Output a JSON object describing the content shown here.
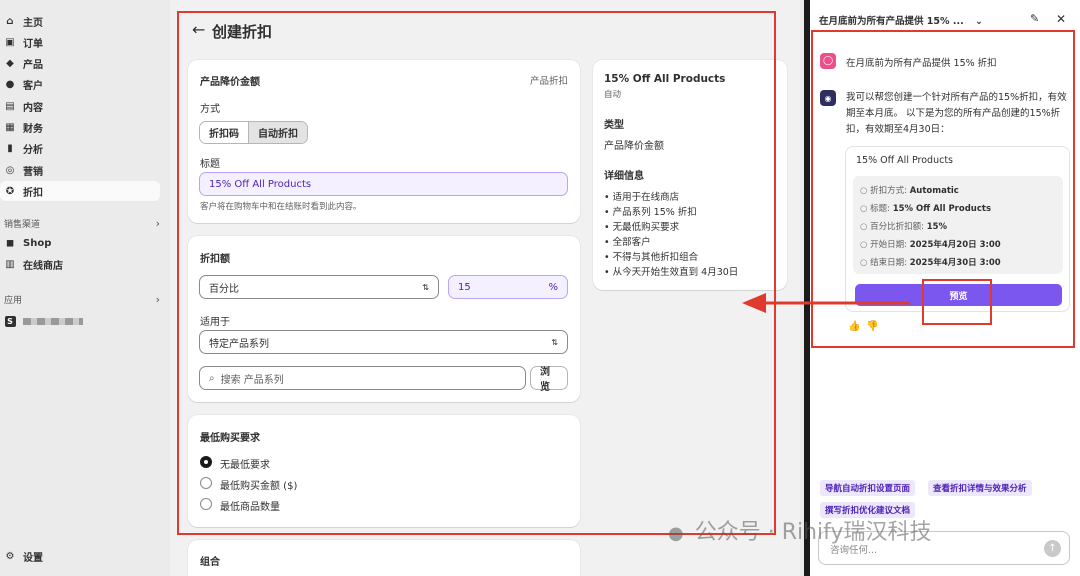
{
  "sidebar": {
    "items": [
      {
        "label": "主页",
        "icon": "home-icon"
      },
      {
        "label": "订单",
        "icon": "orders-icon"
      },
      {
        "label": "产品",
        "icon": "tag-icon"
      },
      {
        "label": "客户",
        "icon": "person-icon"
      },
      {
        "label": "内容",
        "icon": "content-icon"
      },
      {
        "label": "财务",
        "icon": "bank-icon"
      },
      {
        "label": "分析",
        "icon": "chart-icon"
      },
      {
        "label": "营销",
        "icon": "target-icon"
      },
      {
        "label": "折扣",
        "icon": "discount-icon"
      }
    ],
    "channels_label": "销售渠道",
    "channels": [
      {
        "label": "Shop",
        "icon": "shop-icon"
      },
      {
        "label": "在线商店",
        "icon": "store-icon"
      }
    ],
    "apps_label": "应用",
    "settings_label": "设置"
  },
  "main": {
    "back_icon": "arrow-left-icon",
    "title": "创建折扣",
    "card1": {
      "heading": "产品降价金额",
      "type_tag": "产品折扣",
      "method_label": "方式",
      "method_options": [
        "折扣码",
        "自动折扣"
      ],
      "title_label": "标题",
      "title_value": "15% Off All Products",
      "title_help": "客户将在购物车中和在结账时看到此内容。"
    },
    "card2": {
      "heading": "折扣额",
      "type_value": "百分比",
      "percent_value": "15",
      "percent_suffix": "%",
      "applies_label": "适用于",
      "applies_value": "特定产品系列",
      "search_placeholder": "搜索 产品系列",
      "browse_label": "浏览"
    },
    "card3": {
      "heading": "最低购买要求",
      "options": [
        "无最低要求",
        "最低购买金额 ($)",
        "最低商品数量"
      ]
    },
    "card4": {
      "heading": "组合"
    },
    "summary": {
      "title": "15% Off All Products",
      "subtitle": "自动",
      "type_label": "类型",
      "type_value": "产品降价金额",
      "details_label": "详细信息",
      "details": [
        "适用于在线商店",
        "产品系列 15% 折扣",
        "无最低购买要求",
        "全部客户",
        "不得与其他折扣组合",
        "从今天开始生效直到 4月30日"
      ]
    }
  },
  "panel": {
    "header_title": "在月底前为所有产品提供 15% ...",
    "user_message": "在月底前为所有产品提供 15% 折扣",
    "assistant_message": "我可以帮您创建一个针对所有产品的15%折扣，有效期至本月底。 以下是为您的所有产品创建的15%折扣，有效期至4月30日：",
    "card_title": "15% Off All Products",
    "card_items": [
      {
        "key": "折扣方式: ",
        "value": "Automatic"
      },
      {
        "key": "标题: ",
        "value": "15% Off All Products"
      },
      {
        "key": "百分比折扣额: ",
        "value": "15%"
      },
      {
        "key": "开始日期: ",
        "value": "2025年4月20日 3:00"
      },
      {
        "key": "结束日期: ",
        "value": "2025年4月30日 3:00"
      }
    ],
    "preview_label": "预览",
    "suggestions": [
      "导航自动折扣设置页面",
      "查看折扣详情与效果分析",
      "撰写折扣优化建议文档"
    ],
    "input_placeholder": "咨询任何...",
    "watermark": "公众号 · Rihify瑞汉科技",
    "accent_color": "#7b57f0"
  }
}
